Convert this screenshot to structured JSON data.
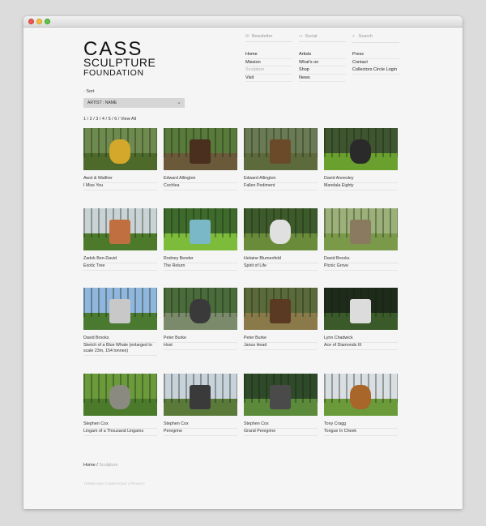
{
  "logo": {
    "line1": "CASS",
    "line2": "SCULPTURE",
    "line3": "FOUNDATION"
  },
  "utility": [
    {
      "label": "Newsletter",
      "icon": "✉"
    },
    {
      "label": "Social",
      "icon": "↪"
    },
    {
      "label": "Search",
      "icon": "⌕"
    }
  ],
  "nav": {
    "col1": [
      "Home",
      "Mission",
      "Sculpture",
      "Visit"
    ],
    "col2": [
      "Artists",
      "What's on",
      "Shop",
      "News"
    ],
    "col3": [
      "Press",
      "Contact",
      "Collectors Circle Login"
    ]
  },
  "sort": {
    "label": "· Sort",
    "selected": "ARTIST : NAME",
    "chevron": "⌄"
  },
  "pager": "1 / 2 / 3 / 4 / 5 / 6 / View All",
  "works": [
    {
      "artist": "Awst & Walther",
      "title": "I Miss You",
      "sky": "#6f8a4e",
      "ground": "#4d6a2a",
      "sculpt": "#d4a82a"
    },
    {
      "artist": "Edward Allington",
      "title": "Cochlea",
      "sky": "#587a3b",
      "ground": "#6b5a3a",
      "sculpt": "#4a2e1e"
    },
    {
      "artist": "Edward Allington",
      "title": "Fallen Pediment",
      "sky": "#6a7a55",
      "ground": "#5d6a3b",
      "sculpt": "#6b4a2a"
    },
    {
      "artist": "David Annesley",
      "title": "Mandala Eighty",
      "sky": "#3f5530",
      "ground": "#6aa02e",
      "sculpt": "#2a2a2a"
    },
    {
      "artist": "Zadok Ben-David",
      "title": "Exotic Tree",
      "sky": "#c9d3d6",
      "ground": "#4d7a2a",
      "sculpt": "#c07040"
    },
    {
      "artist": "Rodney Bender",
      "title": "The Return",
      "sky": "#3e6a2c",
      "ground": "#7dbb3a",
      "sculpt": "#7ab8c8"
    },
    {
      "artist": "Helaine Blumenfeld",
      "title": "Spirit of Life",
      "sky": "#3d5a2b",
      "ground": "#6a8c3a",
      "sculpt": "#e0e0e0"
    },
    {
      "artist": "David Brooks",
      "title": "Picnic Grove",
      "sky": "#9cb07a",
      "ground": "#7a9a4a",
      "sculpt": "#8a7a60"
    },
    {
      "artist": "David Brooks",
      "title": "Sketch of a Blue Whale (enlarged to scale 23m, 154 tonnes)",
      "sky": "#8fb6dc",
      "ground": "#4a7a30",
      "sculpt": "#c8c8c8"
    },
    {
      "artist": "Peter Burke",
      "title": "Host",
      "sky": "#4a6b3a",
      "ground": "#7a8a6a",
      "sculpt": "#3a3a3a"
    },
    {
      "artist": "Peter Burke",
      "title": "Janus Head",
      "sky": "#5a6a3a",
      "ground": "#8a7a4a",
      "sculpt": "#5a3a22"
    },
    {
      "artist": "Lynn Chadwick",
      "title": "Ace of Diamonds III",
      "sky": "#1e2a1a",
      "ground": "#3a5a2a",
      "sculpt": "#dcdcdc"
    },
    {
      "artist": "Stephen Cox",
      "title": "Lingam of a Thousand Lingams",
      "sky": "#6a9a3a",
      "ground": "#4a7a2a",
      "sculpt": "#8a8a80"
    },
    {
      "artist": "Stephen Cox",
      "title": "Peregrine",
      "sky": "#c8d2da",
      "ground": "#5a7a3a",
      "sculpt": "#3a3a3a"
    },
    {
      "artist": "Stephen Cox",
      "title": "Grand Peregrine",
      "sky": "#2e4a28",
      "ground": "#5a8a3a",
      "sculpt": "#4a4a4a"
    },
    {
      "artist": "Tony Cragg",
      "title": "Tongue In Cheek",
      "sky": "#d8dee2",
      "ground": "#6a9a3a",
      "sculpt": "#a8662a"
    }
  ],
  "breadcrumb": {
    "home": "Home",
    "sep": " / ",
    "current": "Sculpture"
  },
  "footer": "TERMS AND CONDITIONS | PRIVACY"
}
